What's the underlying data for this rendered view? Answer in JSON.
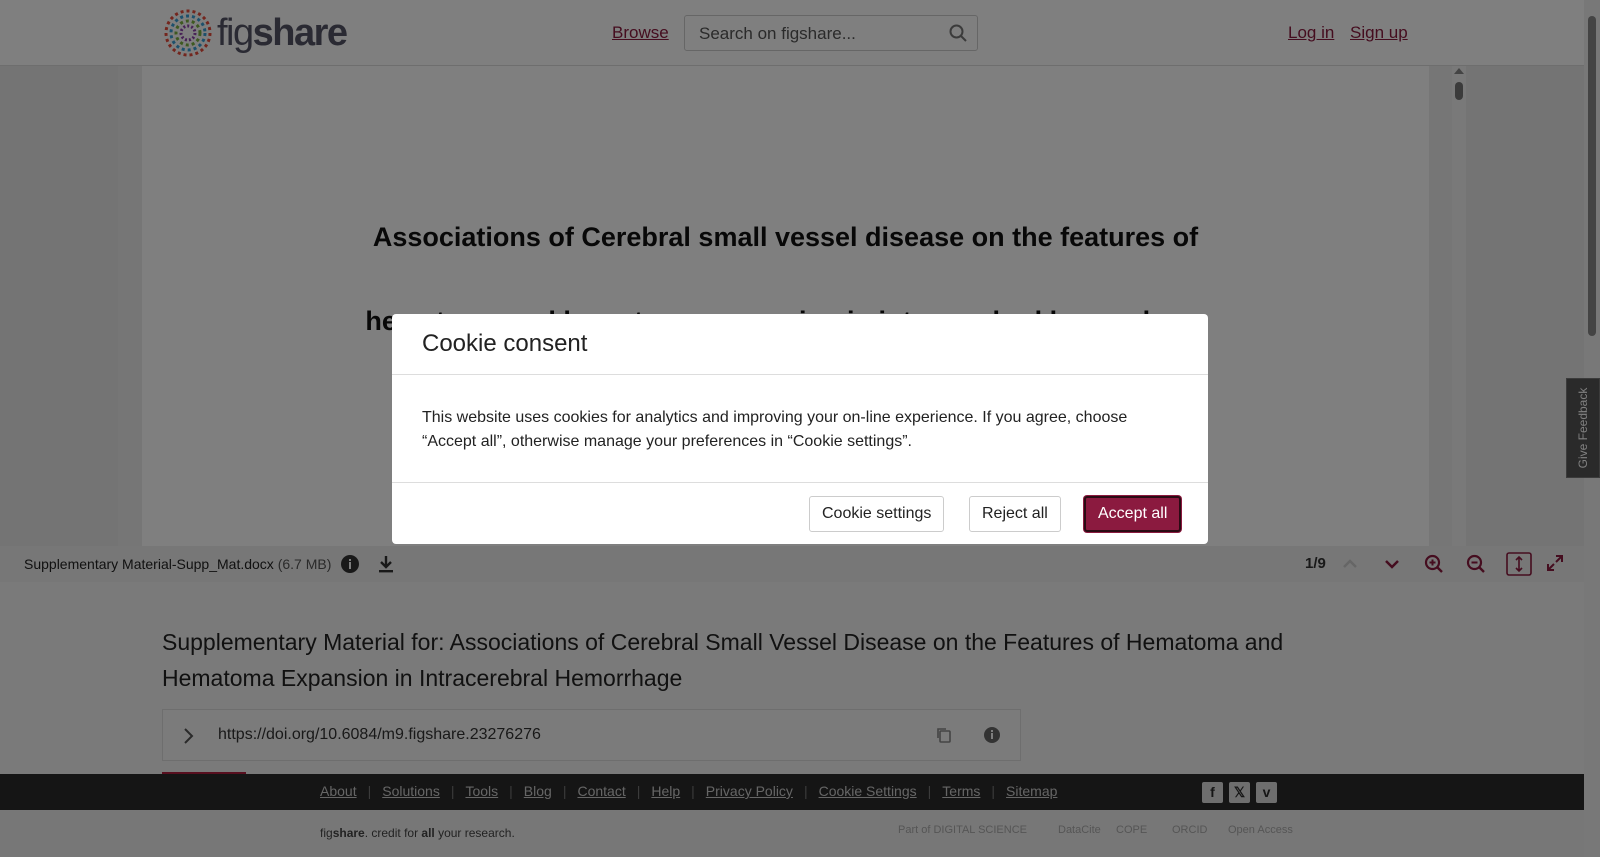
{
  "header": {
    "logo_text_light": "fig",
    "logo_text_bold": "share",
    "browse_label": "Browse",
    "search_placeholder": "Search on figshare...",
    "login_label": "Log in",
    "signup_label": "Sign up"
  },
  "viewer": {
    "doc_line1": "Associations of Cerebral small vessel disease on the features of",
    "doc_line2": "hematoma and hematoma expansion in intracerebral hemorrhage",
    "file_name": "Supplementary Material-Supp_Mat.docx",
    "file_size": "(6.7 MB)",
    "page_count": "1/9"
  },
  "item": {
    "title": "Supplementary Material for: Associations of Cerebral Small Vessel Disease on the Features of Hematoma and Hematoma Expansion in Intracerebral Hemorrhage",
    "doi": "https://doi.org/10.6084/m9.figshare.23276276"
  },
  "feedback_label": "Give Feedback",
  "footer": {
    "links": [
      "About",
      "Solutions",
      "Tools",
      "Blog",
      "Contact",
      "Help",
      "Privacy Policy",
      "Cookie Settings",
      "Terms",
      "Sitemap"
    ],
    "credit_pre": "fig",
    "credit_bold": "share",
    "credit_mid": ". credit for ",
    "credit_all": "all",
    "credit_post": " your research.",
    "partners": [
      "Part of DIGITAL SCIENCE",
      "DataCite",
      "COPE",
      "ORCID",
      "Open Access"
    ]
  },
  "cookie_modal": {
    "title": "Cookie consent",
    "body": "This website uses cookies for analytics and improving your on-line experience. If you agree, choose “Accept all”, otherwise manage your preferences in “Cookie settings”.",
    "settings_label": "Cookie settings",
    "reject_label": "Reject all",
    "accept_label": "Accept all"
  },
  "colors": {
    "brand": "#8b1a3f",
    "overlay": "rgba(0,0,0,0.5)",
    "footer_dark": "#2b2b2b"
  }
}
